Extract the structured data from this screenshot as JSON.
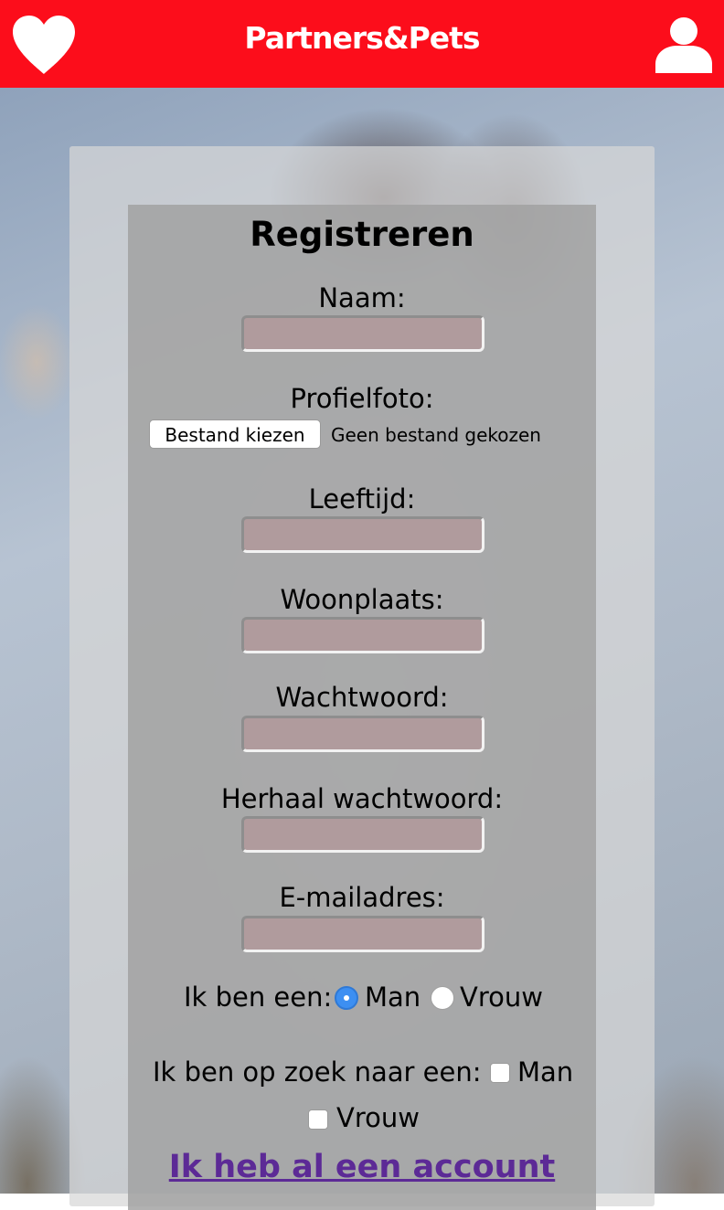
{
  "header": {
    "brand": "Partners&Pets",
    "favorites_icon": "heart-icon",
    "profile_icon": "user-icon"
  },
  "form": {
    "title": "Registreren",
    "name_label": "Naam:",
    "photo_label": "Profielfoto:",
    "file_button": "Bestand kiezen",
    "file_status": "Geen bestand gekozen",
    "age_label": "Leeftijd:",
    "city_label": "Woonplaats:",
    "password_label": "Wachtwoord:",
    "password_repeat_label": "Herhaal wachtwoord:",
    "email_label": "E-mailadres:",
    "gender_label": "Ik ben een:",
    "gender_options": [
      {
        "label": "Man",
        "selected": true
      },
      {
        "label": "Vrouw",
        "selected": false
      }
    ],
    "seeking_label": "Ik ben op zoek naar een:",
    "seeking_options": [
      {
        "label": "Man",
        "checked": false
      },
      {
        "label": "Vrouw",
        "checked": false
      }
    ],
    "login_link": "Ik heb al een account"
  },
  "colors": {
    "header_red": "#fc0d1b",
    "input_fill": "#b09b9d",
    "link_purple": "#5c2a96",
    "radio_blue": "#3d8ff2"
  }
}
